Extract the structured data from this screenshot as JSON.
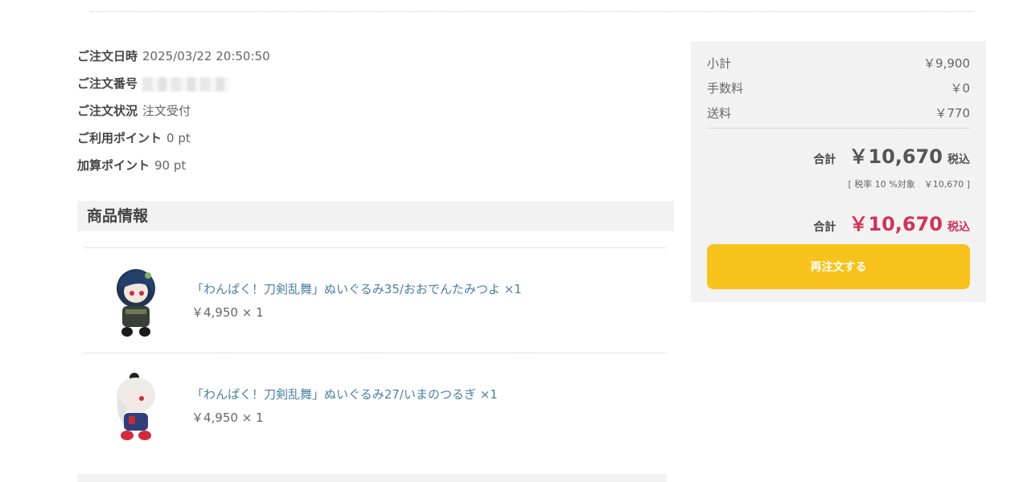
{
  "order": {
    "date_label": "ご注文日時",
    "date_value": "2025/03/22 20:50:50",
    "number_label": "ご注文番号",
    "status_label": "ご注文状況",
    "status_value": "注文受付",
    "used_points_label": "ご利用ポイント",
    "used_points_value": "0 pt",
    "added_points_label": "加算ポイント",
    "added_points_value": "90 pt"
  },
  "products_section": {
    "title": "商品情報",
    "items": [
      {
        "name": "「わんぱく！刀剣乱舞」ぬいぐるみ35/おおでんたみつよ ×1",
        "price": "￥4,950 × 1",
        "image_icon": "plush-figure-dark-haired"
      },
      {
        "name": "「わんぱく！刀剣乱舞」ぬいぐるみ27/いまのつるぎ ×1",
        "price": "￥4,950 × 1",
        "image_icon": "plush-figure-white-haired"
      }
    ]
  },
  "summary": {
    "subtotal_label": "小計",
    "subtotal_value": "￥9,900",
    "fee_label": "手数料",
    "fee_value": "￥0",
    "shipping_label": "送料",
    "shipping_value": "￥770",
    "total_label": "合計",
    "total_value": "￥10,670",
    "tax_suffix": "税込",
    "tax_note": "[ 税率 10 %対象　￥10,670 ]",
    "grand_total_label": "合計",
    "grand_total_value": "￥10,670",
    "grand_total_suffix": "税込",
    "reorder_button": "再注文する"
  },
  "colors": {
    "accent_total": "#d0335a",
    "button": "#f8c21c",
    "link": "#4a7fa3",
    "panel_bg": "#f2f2f2"
  }
}
